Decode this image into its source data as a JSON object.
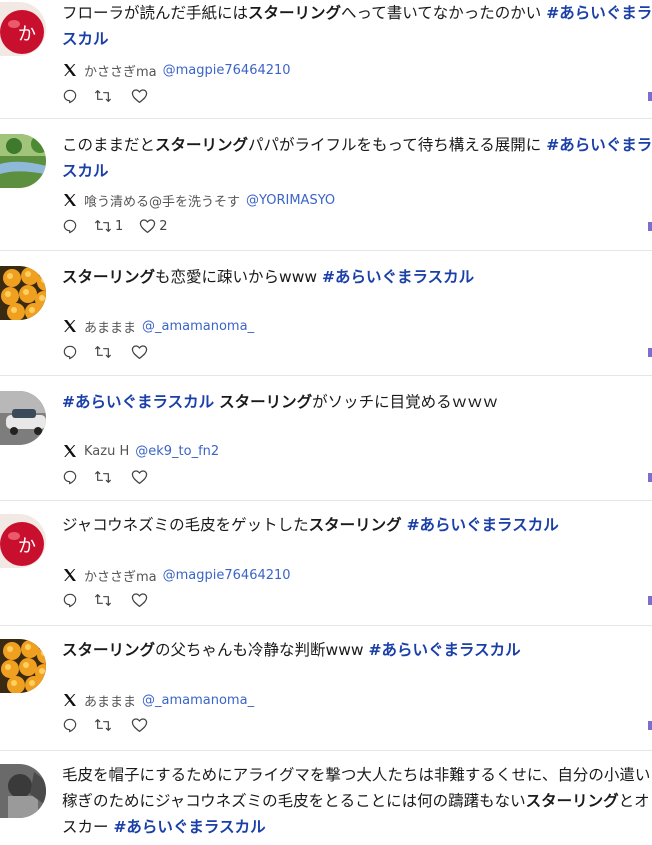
{
  "posts": [
    {
      "segments": [
        {
          "t": "フローラが読んだ手紙には",
          "s": "n"
        },
        {
          "t": "スターリング",
          "s": "b"
        },
        {
          "t": "へって書いてなかったのかい ",
          "s": "n"
        },
        {
          "t": "#あらいぐまラスカル",
          "s": "h"
        }
      ],
      "name": "かささぎma",
      "handle": "@magpie76464210",
      "retweets": "",
      "likes": "",
      "avatar": "apple"
    },
    {
      "segments": [
        {
          "t": "このままだと",
          "s": "n"
        },
        {
          "t": "スターリング",
          "s": "b"
        },
        {
          "t": "パパがライフルをもって待ち構える展開に ",
          "s": "n"
        },
        {
          "t": "#あらいぐまラスカル",
          "s": "h"
        }
      ],
      "name": "喰う清める@手を洗うそす",
      "handle": "@YORIMASYO",
      "retweets": "1",
      "likes": "2",
      "avatar": "river"
    },
    {
      "segments": [
        {
          "t": "スターリング",
          "s": "b"
        },
        {
          "t": "も恋愛に疎いからwww ",
          "s": "n"
        },
        {
          "t": "#あらいぐまラスカル",
          "s": "h"
        }
      ],
      "name": "あままま",
      "handle": "@_amamanoma_",
      "retweets": "",
      "likes": "",
      "avatar": "fruit"
    },
    {
      "segments": [
        {
          "t": "#あらいぐまラスカル",
          "s": "h"
        },
        {
          "t": " ",
          "s": "n"
        },
        {
          "t": "スターリング",
          "s": "b"
        },
        {
          "t": "がソッチに目覚めるｗｗｗ",
          "s": "n"
        }
      ],
      "name": "Kazu H",
      "handle": "@ek9_to_fn2",
      "retweets": "",
      "likes": "",
      "avatar": "car"
    },
    {
      "segments": [
        {
          "t": "ジャコウネズミの毛皮をゲットした",
          "s": "n"
        },
        {
          "t": "スターリング",
          "s": "b"
        },
        {
          "t": " ",
          "s": "n"
        },
        {
          "t": "#あらいぐまラスカル",
          "s": "h"
        }
      ],
      "name": "かささぎma",
      "handle": "@magpie76464210",
      "retweets": "",
      "likes": "",
      "avatar": "apple"
    },
    {
      "segments": [
        {
          "t": "スターリング",
          "s": "b"
        },
        {
          "t": "の父ちゃんも冷静な判断www ",
          "s": "n"
        },
        {
          "t": "#あらいぐまラスカル",
          "s": "h"
        }
      ],
      "name": "あままま",
      "handle": "@_amamanoma_",
      "retweets": "",
      "likes": "",
      "avatar": "fruit"
    },
    {
      "segments": [
        {
          "t": "毛皮を帽子にするためにアライグマを撃つ大人たちは非難するくせに、自分の小遣い稼ぎのためにジャコウネズミの毛皮をとることには何の躊躇もない",
          "s": "n"
        },
        {
          "t": "スターリング",
          "s": "b"
        },
        {
          "t": "とオスカー ",
          "s": "n"
        },
        {
          "t": "#あらいぐまラスカル",
          "s": "h"
        }
      ],
      "name": "",
      "handle": "",
      "retweets": "",
      "likes": "",
      "avatar": "bw"
    }
  ],
  "colors": {
    "hashtag": "#1a3fa8",
    "handle": "#3b64c8",
    "divider": "#e6e6e6"
  }
}
